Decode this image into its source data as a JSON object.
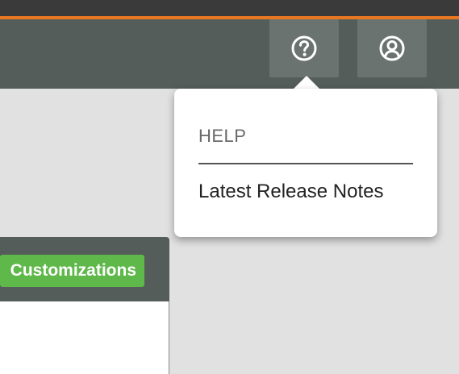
{
  "header": {
    "help_button": {
      "icon": "help-icon",
      "tooltip": ""
    },
    "account_button": {
      "icon": "user-icon"
    }
  },
  "help_menu": {
    "heading": "HELP",
    "items": [
      {
        "label": "Latest Release Notes"
      }
    ]
  },
  "panel": {
    "chip_label": "Customizations"
  },
  "colors": {
    "accent": "#e87722",
    "header": "#545d5a",
    "chip": "#5fb84a"
  }
}
